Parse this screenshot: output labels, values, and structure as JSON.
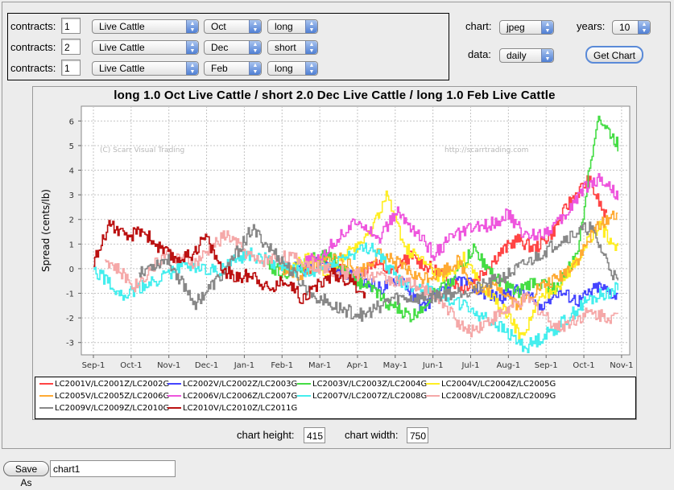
{
  "form": {
    "rows": [
      {
        "label": "contracts:",
        "qty": "1",
        "commodity": "Live Cattle",
        "month": "Oct",
        "side": "long"
      },
      {
        "label": "contracts:",
        "qty": "2",
        "commodity": "Live Cattle",
        "month": "Dec",
        "side": "short"
      },
      {
        "label": "contracts:",
        "qty": "1",
        "commodity": "Live Cattle",
        "month": "Feb",
        "side": "long"
      }
    ]
  },
  "options": {
    "chart_label": "chart:",
    "chart_value": "jpeg",
    "years_label": "years:",
    "years_value": "10",
    "data_label": "data:",
    "data_value": "daily",
    "get_chart": "Get Chart"
  },
  "chart_data": {
    "type": "line",
    "title": "long 1.0 Oct Live Cattle / short 2.0 Dec Live Cattle / long 1.0 Feb Live Cattle",
    "ylabel": "Spread (cents/lb)",
    "xlabel": "",
    "watermark_left": "(C) Scarr Visual Trading",
    "watermark_right": "http://scarrtrading.com",
    "ylim": [
      -3.5,
      6.6
    ],
    "yticks": [
      "-3",
      "-2",
      "-1",
      "0",
      "1",
      "2",
      "3",
      "4",
      "5",
      "6"
    ],
    "xticks": [
      "Sep-1",
      "Oct-1",
      "Nov-1",
      "Dec-1",
      "Jan-1",
      "Feb-1",
      "Mar-1",
      "Apr-1",
      "May-1",
      "Jun-1",
      "Jul-1",
      "Aug-1",
      "Sep-1",
      "Oct-1",
      "Nov-1"
    ],
    "grid": true,
    "series": [
      {
        "name": "LC2001V/LC2001Z/LC2002G",
        "color": "#ff4444",
        "start": 5.5,
        "end": 13.6,
        "values": [
          -0.1,
          0.2,
          0.0,
          -0.4,
          0.3,
          -0.2,
          0.5,
          0.1,
          -0.3,
          -0.8,
          -0.2,
          0.6,
          1.2,
          0.8,
          1.5,
          2.8,
          3.6,
          2.0
        ]
      },
      {
        "name": "LC2002V/LC2002Z/LC2003G",
        "color": "#4444ff",
        "start": 5.0,
        "end": 13.9,
        "values": [
          0.2,
          -0.1,
          0.3,
          -0.2,
          -0.5,
          -0.8,
          -0.3,
          -1.6,
          -1.0,
          -0.4,
          -0.9,
          -1.2,
          -0.8,
          -1.5,
          -0.9,
          -1.3,
          -0.7,
          -1.1
        ]
      },
      {
        "name": "LC2003V/LC2003Z/LC2004G",
        "color": "#44dd44",
        "start": 4.6,
        "end": 13.9,
        "values": [
          0.1,
          -0.2,
          0.3,
          0.6,
          -0.3,
          -0.8,
          -1.5,
          -2.0,
          -1.1,
          -0.4,
          0.8,
          -0.3,
          -1.0,
          -0.5,
          -0.8,
          0.5,
          6.2,
          5.0
        ]
      },
      {
        "name": "LC2004V/LC2004Z/LC2005G",
        "color": "#ffee22",
        "start": 5.2,
        "end": 13.9,
        "values": [
          0.0,
          0.4,
          -0.2,
          0.7,
          1.2,
          3.0,
          0.8,
          0.2,
          -0.5,
          0.4,
          -0.8,
          -1.6,
          -2.8,
          -1.2,
          -0.6,
          0.5,
          1.8,
          0.8
        ]
      },
      {
        "name": "LC2005V/LC2005Z/LC2006G",
        "color": "#ffaa33",
        "start": 4.9,
        "end": 13.9,
        "values": [
          0.1,
          -0.3,
          0.2,
          0.5,
          -0.2,
          0.6,
          0.2,
          -0.4,
          -0.2,
          0.3,
          -1.0,
          -0.7,
          -1.5,
          -0.8,
          -0.4,
          0.4,
          1.8,
          2.3
        ]
      },
      {
        "name": "LC2006V/LC2006Z/LC2007G",
        "color": "#ee55dd",
        "start": 5.6,
        "end": 13.9,
        "values": [
          0.2,
          0.6,
          1.4,
          2.0,
          1.2,
          2.3,
          1.5,
          0.6,
          1.3,
          1.6,
          1.8,
          2.2,
          1.3,
          1.5,
          2.0,
          3.2,
          3.7,
          3.0
        ]
      },
      {
        "name": "LC2007V/LC2007Z/LC2008G",
        "color": "#44eeee",
        "start": 0.0,
        "end": 13.9,
        "values": [
          0.0,
          -1.1,
          -0.5,
          0.2,
          -0.1,
          0.6,
          0.2,
          -0.3,
          0.4,
          0.9,
          -0.6,
          -0.9,
          -1.5,
          -2.2,
          -3.2,
          -2.4,
          -1.3,
          -0.8
        ]
      },
      {
        "name": "LC2008V/LC2008Z/LC2009G",
        "color": "#f5a8a8",
        "start": 0.3,
        "end": 13.9,
        "values": [
          0.4,
          -0.7,
          0.6,
          0.2,
          1.4,
          0.3,
          0.5,
          0.1,
          -0.2,
          -0.3,
          -0.6,
          -1.1,
          -2.6,
          -1.9,
          -1.2,
          -2.4,
          -1.8,
          -2.0
        ]
      },
      {
        "name": "LC2009V/LC2009Z/LC2010G",
        "color": "#888888",
        "start": 1.2,
        "end": 13.9,
        "values": [
          -0.1,
          0.4,
          -1.4,
          -0.2,
          1.6,
          0.4,
          -0.9,
          -1.6,
          -1.9,
          -1.2,
          -1.2,
          -1.0,
          -0.8,
          -0.3,
          0.4,
          1.2,
          1.7,
          -0.6
        ]
      },
      {
        "name": "LC2010V/LC2010Z/LC2011G",
        "color": "#bb1111",
        "start": 0.0,
        "end": 7.2,
        "values": [
          0.2,
          1.9,
          1.2,
          1.6,
          0.9,
          0.4,
          0.5,
          1.3,
          0.0,
          -0.4,
          -0.2,
          -0.9,
          -0.4,
          -1.2,
          -0.7,
          -0.2,
          -0.5,
          -1.0
        ]
      }
    ]
  },
  "dims": {
    "height_label": "chart height:",
    "height_value": "415",
    "width_label": "chart width:",
    "width_value": "750"
  },
  "footer": {
    "save_as": "Save As",
    "filename": "chart1"
  }
}
